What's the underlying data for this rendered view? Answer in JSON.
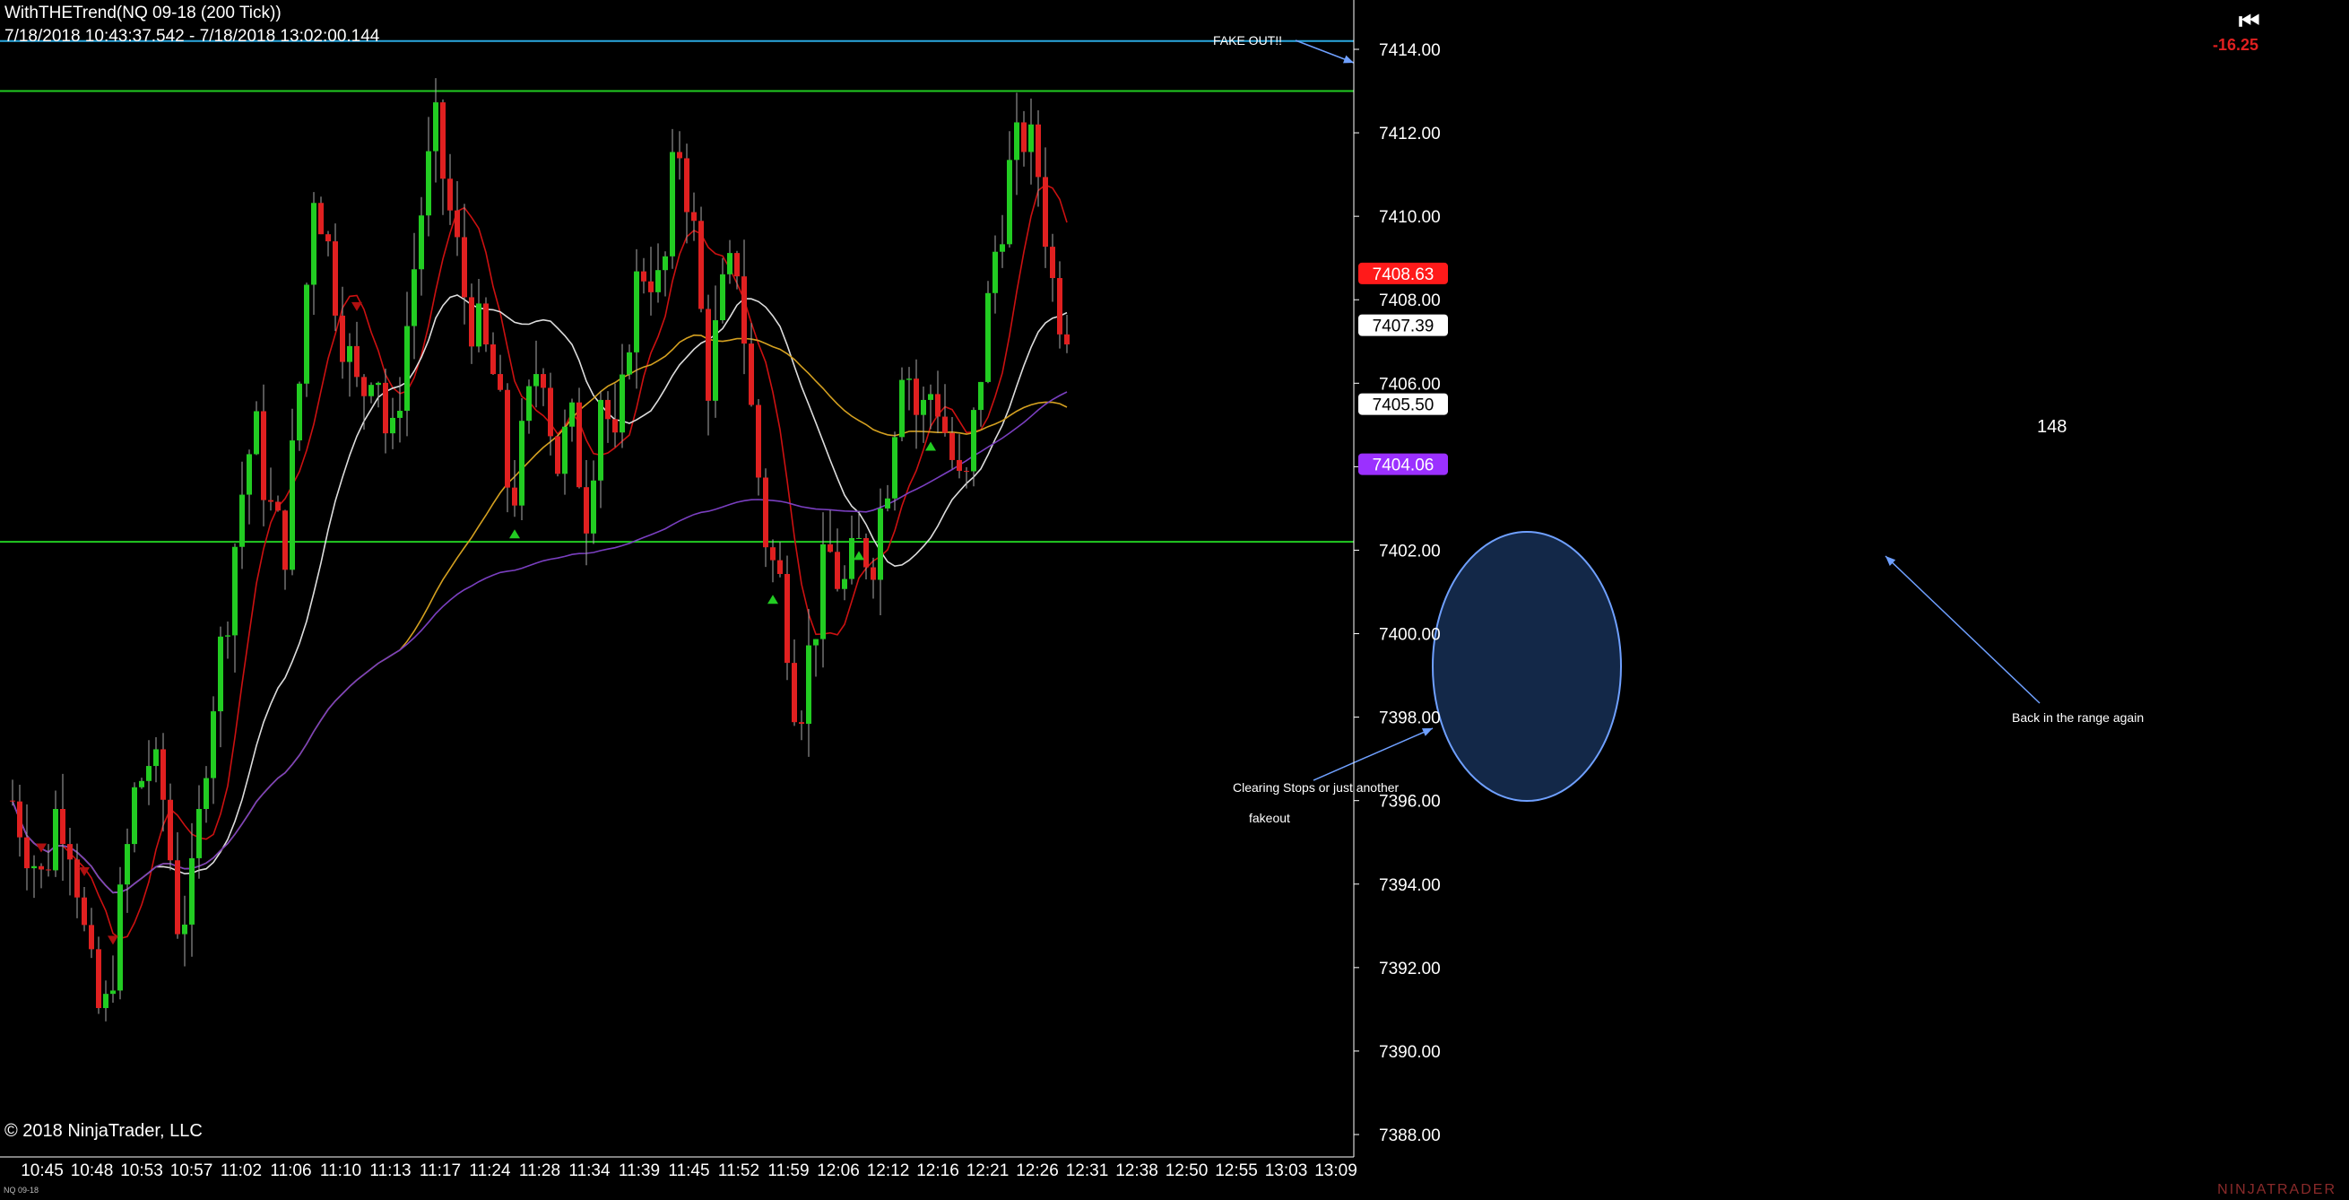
{
  "window": {
    "title": "WithTHETrend(NQ 09-18 (200 Tick))",
    "range": "7/18/2018 10:43:37.542 - 7/18/2018 13:02:00.144",
    "copyright": "© 2018 NinjaTrader, LLC",
    "symbol": "NQ 09-18",
    "brand": "NINJATRADER",
    "pnl": "-16.25",
    "skip_icon": "skip-to-start-icon"
  },
  "chart_data": {
    "type": "candlestick",
    "instrument": "NQ 09-18",
    "bar_type": "200 Tick",
    "ylim": [
      7387.5,
      7415.5
    ],
    "y_ticks": [
      7388,
      7390,
      7392,
      7394,
      7396,
      7398,
      7400,
      7402,
      7404,
      7406,
      7408,
      7410,
      7412,
      7414
    ],
    "y_tick_labels": [
      "7388.00",
      "7390.00",
      "7392.00",
      "7394.00",
      "7396.00",
      "7398.00",
      "7400.00",
      "7402.00",
      "7404.00",
      "7406.00",
      "7408.00",
      "7410.00",
      "7412.00",
      "7414.00"
    ],
    "x_tick_labels": [
      "10:45",
      "10:48",
      "10:53",
      "10:57",
      "11:02",
      "11:06",
      "11:10",
      "11:13",
      "11:17",
      "11:24",
      "11:28",
      "11:34",
      "11:39",
      "11:45",
      "11:52",
      "11:59",
      "12:06",
      "12:12",
      "12:16",
      "12:21",
      "12:26",
      "12:31",
      "12:38",
      "12:50",
      "12:55",
      "13:03",
      "13:09"
    ],
    "bar_count": 148,
    "bar_count_label": "148",
    "close_path": [
      [
        0,
        7396
      ],
      [
        4,
        7395
      ],
      [
        8,
        7394
      ],
      [
        12,
        7396
      ],
      [
        16,
        7395
      ],
      [
        20,
        7392
      ],
      [
        24,
        7390.5
      ],
      [
        28,
        7393
      ],
      [
        32,
        7396
      ],
      [
        36,
        7397
      ],
      [
        40,
        7396
      ],
      [
        44,
        7393
      ],
      [
        48,
        7394
      ],
      [
        52,
        7398
      ],
      [
        56,
        7400
      ],
      [
        60,
        7403
      ],
      [
        64,
        7405
      ],
      [
        68,
        7403
      ],
      [
        72,
        7402
      ],
      [
        76,
        7406
      ],
      [
        80,
        7411
      ],
      [
        84,
        7409
      ],
      [
        88,
        7407
      ],
      [
        92,
        7405.5
      ],
      [
        96,
        7407
      ],
      [
        100,
        7404
      ],
      [
        104,
        7407
      ],
      [
        108,
        7410
      ],
      [
        112,
        7412
      ],
      [
        116,
        7410
      ],
      [
        120,
        7408
      ],
      [
        124,
        7407
      ],
      [
        128,
        7406
      ],
      [
        132,
        7403
      ],
      [
        136,
        7405
      ],
      [
        140,
        7407
      ],
      [
        144,
        7404
      ],
      [
        148,
        7405
      ],
      [
        152,
        7403
      ],
      [
        156,
        7406
      ],
      [
        160,
        7404
      ],
      [
        164,
        7408
      ],
      [
        168,
        7409
      ],
      [
        172,
        7408
      ],
      [
        176,
        7412
      ],
      [
        180,
        7410
      ],
      [
        184,
        7406
      ],
      [
        188,
        7408
      ],
      [
        192,
        7409
      ],
      [
        196,
        7405
      ],
      [
        200,
        7402
      ],
      [
        204,
        7401
      ],
      [
        208,
        7398
      ],
      [
        212,
        7400
      ],
      [
        216,
        7402
      ],
      [
        220,
        7401
      ],
      [
        224,
        7402
      ],
      [
        228,
        7402
      ],
      [
        232,
        7404
      ],
      [
        236,
        7407
      ],
      [
        240,
        7405
      ],
      [
        244,
        7406
      ],
      [
        248,
        7404.5
      ],
      [
        252,
        7403
      ],
      [
        256,
        7406
      ],
      [
        260,
        7409
      ],
      [
        264,
        7411
      ],
      [
        268,
        7412
      ],
      [
        272,
        7411
      ],
      [
        276,
        7408
      ],
      [
        280,
        7407.5
      ],
      [
        282,
        7405.5
      ]
    ],
    "candles": [],
    "price_markers": [
      {
        "label": "7408.63",
        "price": 7408.63,
        "color": "#ff1a1a",
        "text_color": "#ffffff"
      },
      {
        "label": "7407.39",
        "price": 7407.39,
        "color": "#ffffff",
        "text_color": "#000000"
      },
      {
        "label": "7405.50",
        "price": 7405.5,
        "color": "#ffffff",
        "text_color": "#000000"
      },
      {
        "label": "7404.06",
        "price": 7404.06,
        "color": "#9b30ff",
        "text_color": "#ffffff"
      }
    ],
    "horizontal_lines": [
      {
        "price": 7414.2,
        "color": "#2aa8e0",
        "name": "resistance-blue"
      },
      {
        "price": 7413.0,
        "color": "#22cc22",
        "name": "range-high"
      },
      {
        "price": 7402.2,
        "color": "#22cc22",
        "name": "range-low"
      }
    ],
    "moving_averages": [
      {
        "color": "#cc1111",
        "name": "fast-ma"
      },
      {
        "color": "#dddddd",
        "name": "mid-ma"
      },
      {
        "color": "#d4a020",
        "name": "slow-ma"
      },
      {
        "color": "#7a3fc0",
        "name": "long-ma"
      }
    ],
    "annotations": [
      {
        "text": "FAKE OUT!!",
        "x": 143,
        "price": 7414.8
      },
      {
        "text": "Clearing Stops or just another",
        "x": 137,
        "price": 7396.3
      },
      {
        "text": "fakeout",
        "x": 139,
        "price": 7395.5
      },
      {
        "text": "Back in the range again",
        "x": 232,
        "price": 7398.3
      }
    ],
    "colors": {
      "up": "#22cc22",
      "down": "#e02020",
      "wick": "#aaaaaa",
      "axis_text": "#ffffff",
      "ellipse_fill": "#1a3560",
      "ellipse_stroke": "#6fa0ff"
    }
  }
}
